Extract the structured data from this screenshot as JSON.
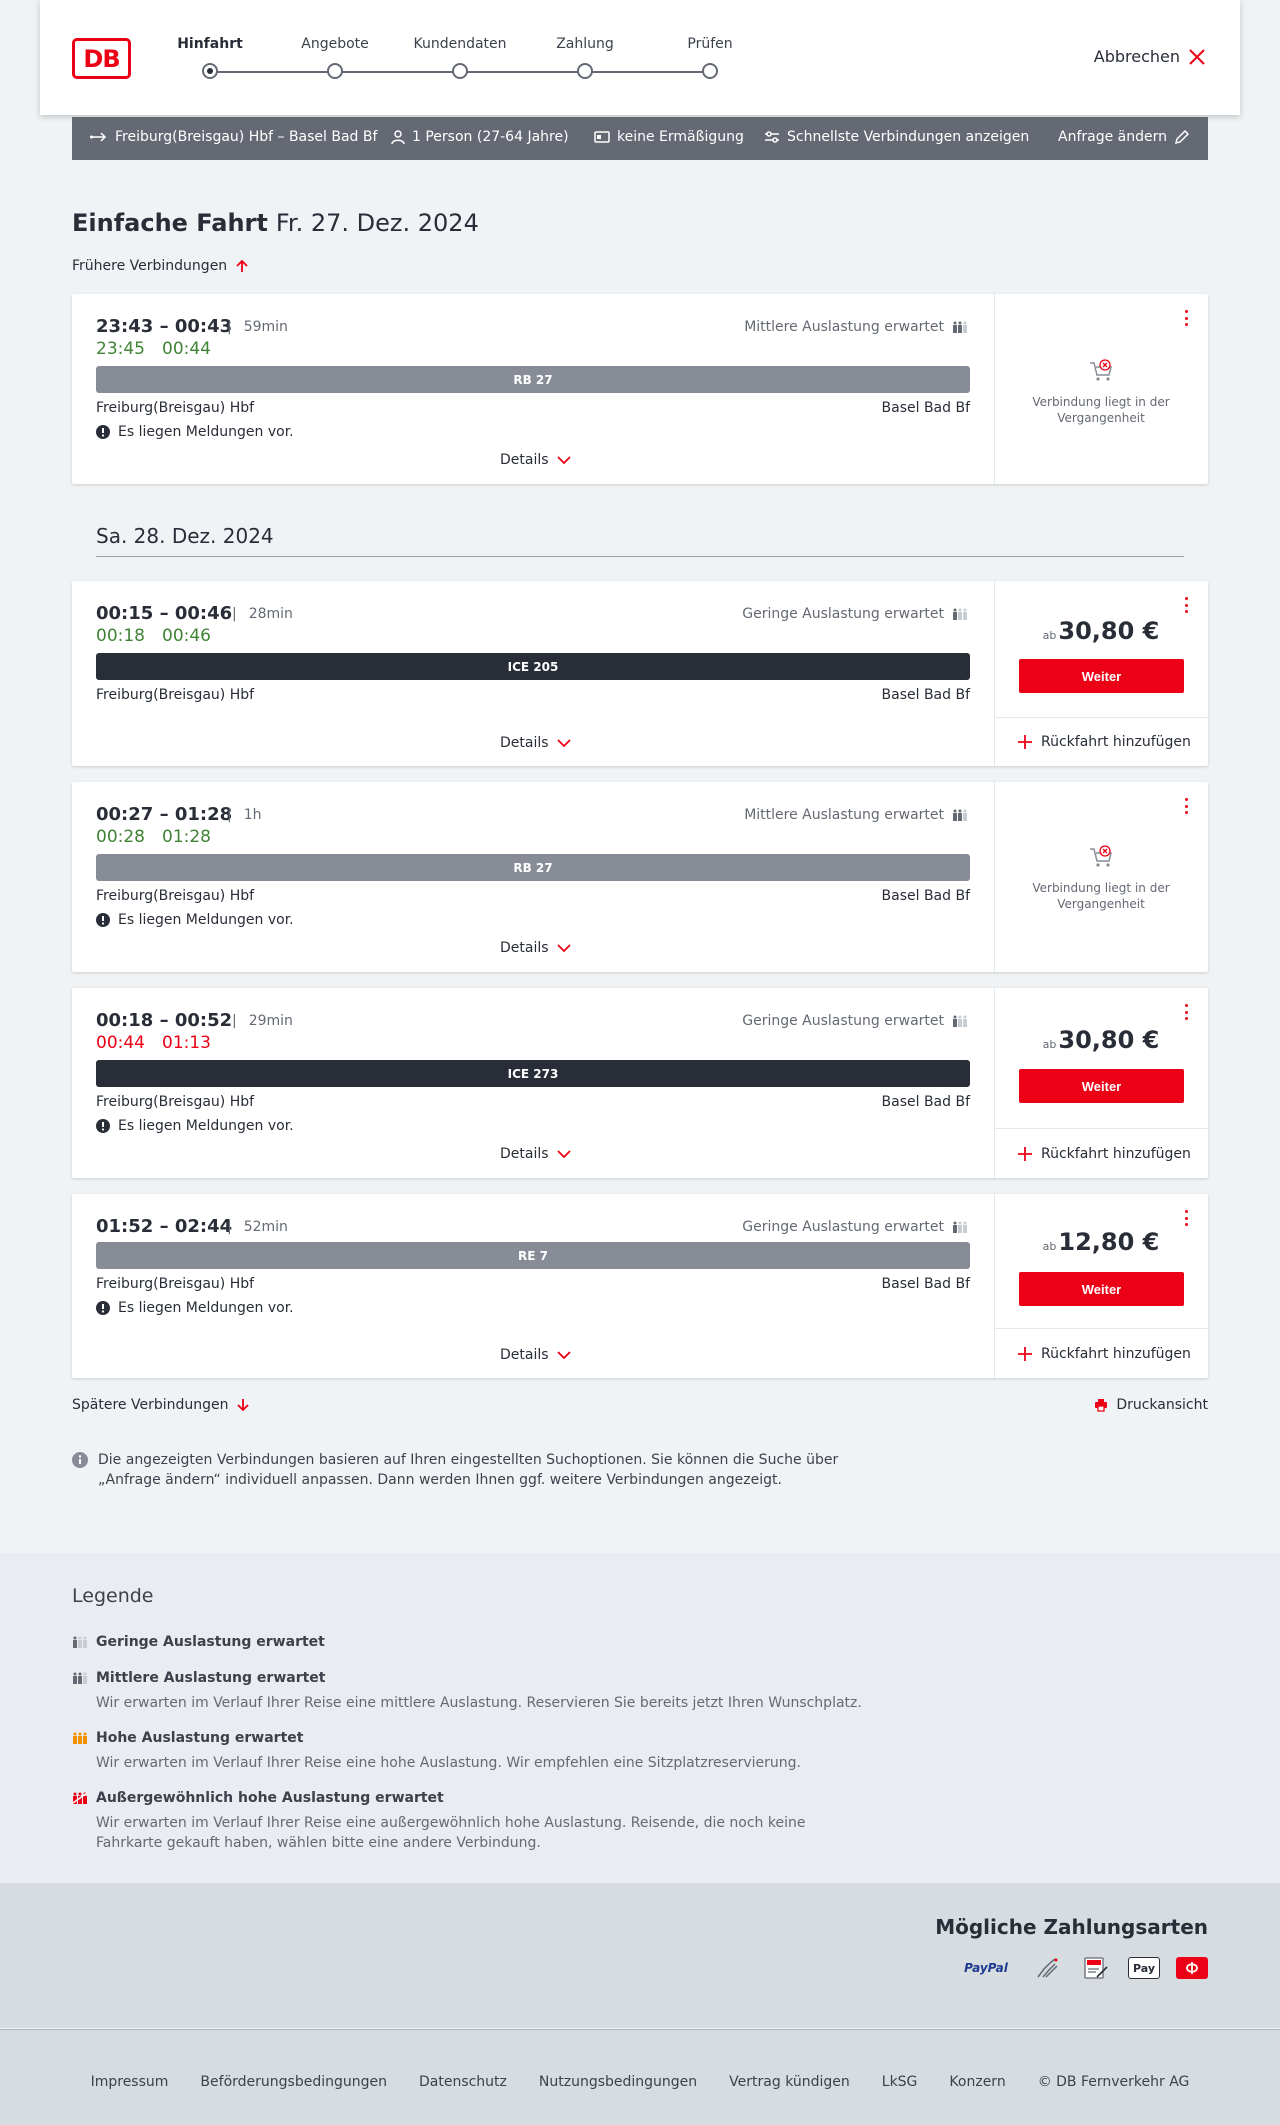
{
  "header": {
    "logo": "DB",
    "steps": [
      "Hinfahrt",
      "Angebote",
      "Kundendaten",
      "Zahlung",
      "Prüfen"
    ],
    "cancel": "Abbrechen"
  },
  "summary": {
    "route": "Freiburg(Breisgau) Hbf – Basel Bad Bf",
    "persons": "1 Person (27-64 Jahre)",
    "discount": "keine Ermäßigung",
    "fastest": "Schnellste Verbindungen anzeigen",
    "change": "Anfrage ändern"
  },
  "title": {
    "trip": "Einfache Fahrt",
    "date": "Fr. 27. Dez. 2024"
  },
  "earlier": "Frühere Verbindungen",
  "later": "Spätere Verbindungen",
  "date2": "Sa. 28. Dez. 2024",
  "connections": [
    {
      "times": "23:43 – 00:43",
      "duration": "59min",
      "rt_dep": "23:45",
      "rt_arr": "00:44",
      "rt_color": "green",
      "load": "Mittlere Auslastung erwartet",
      "load_level": "medium",
      "train": "RB 27",
      "train_color": "grey",
      "from": "Freiburg(Breisgau) Hbf",
      "to": "Basel Bad Bf",
      "message": "Es liegen Meldungen vor.",
      "details": "Details",
      "past": "Verbindung liegt in der Vergangenheit"
    },
    {
      "times": "00:15 – 00:46",
      "duration": "28min",
      "rt_dep": "00:18",
      "rt_arr": "00:46",
      "rt_color": "green",
      "load": "Geringe Auslastung erwartet",
      "load_level": "low",
      "train": "ICE 205",
      "train_color": "dark",
      "from": "Freiburg(Breisgau) Hbf",
      "to": "Basel Bad Bf",
      "details": "Details",
      "price_prefix": "ab",
      "price": "30,80 €",
      "button": "Weiter",
      "return": "Rückfahrt hinzufügen"
    },
    {
      "times": "00:27 – 01:28",
      "duration": "1h",
      "rt_dep": "00:28",
      "rt_arr": "01:28",
      "rt_color": "green",
      "load": "Mittlere Auslastung erwartet",
      "load_level": "medium",
      "train": "RB 27",
      "train_color": "grey",
      "from": "Freiburg(Breisgau) Hbf",
      "to": "Basel Bad Bf",
      "message": "Es liegen Meldungen vor.",
      "details": "Details",
      "past": "Verbindung liegt in der Vergangenheit"
    },
    {
      "times": "00:18 – 00:52",
      "duration": "29min",
      "rt_dep": "00:44",
      "rt_arr": "01:13",
      "rt_color": "red",
      "load": "Geringe Auslastung erwartet",
      "load_level": "low",
      "train": "ICE 273",
      "train_color": "dark",
      "from": "Freiburg(Breisgau) Hbf",
      "to": "Basel Bad Bf",
      "message": "Es liegen Meldungen vor.",
      "details": "Details",
      "price_prefix": "ab",
      "price": "30,80 €",
      "button": "Weiter",
      "return": "Rückfahrt hinzufügen"
    },
    {
      "times": "01:52 – 02:44",
      "duration": "52min",
      "load": "Geringe Auslastung erwartet",
      "load_level": "low",
      "train": "RE 7",
      "train_color": "grey",
      "from": "Freiburg(Breisgau) Hbf",
      "to": "Basel Bad Bf",
      "message": "Es liegen Meldungen vor.",
      "details": "Details",
      "price_prefix": "ab",
      "price": "12,80 €",
      "button": "Weiter",
      "return": "Rückfahrt hinzufügen"
    }
  ],
  "print": "Druckansicht",
  "note": "Die angezeigten Verbindungen basieren auf Ihren eingestellten Suchoptionen. Sie können die Suche über „Anfrage ändern“ individuell anpassen. Dann werden Ihnen ggf. weitere Verbindungen angezeigt.",
  "legend": {
    "title": "Legende",
    "items": [
      {
        "title": "Geringe Auslastung erwartet",
        "desc": ""
      },
      {
        "title": "Mittlere Auslastung erwartet",
        "desc": "Wir erwarten im Verlauf Ihrer Reise eine mittlere Auslastung. Reservieren Sie bereits jetzt Ihren Wunschplatz."
      },
      {
        "title": "Hohe Auslastung erwartet",
        "desc": "Wir erwarten im Verlauf Ihrer Reise eine hohe Auslastung. Wir empfehlen eine Sitzplatzreservierung."
      },
      {
        "title": "Außergewöhnlich hohe Auslastung erwartet",
        "desc": "Wir erwarten im Verlauf Ihrer Reise eine außergewöhnlich hohe Auslastung. Reisende, die noch keine Fahrkarte gekauft haben, wählen bitte eine andere Verbindung."
      }
    ]
  },
  "payment": {
    "title": "Mögliche Zahlungsarten",
    "paypal": "PayPal",
    "applepay": "Pay"
  },
  "footer": [
    "Impressum",
    "Beförderungsbedingungen",
    "Datenschutz",
    "Nutzungsbedingungen",
    "Vertrag kündigen",
    "LkSG",
    "Konzern",
    "© DB Fernverkehr AG"
  ]
}
